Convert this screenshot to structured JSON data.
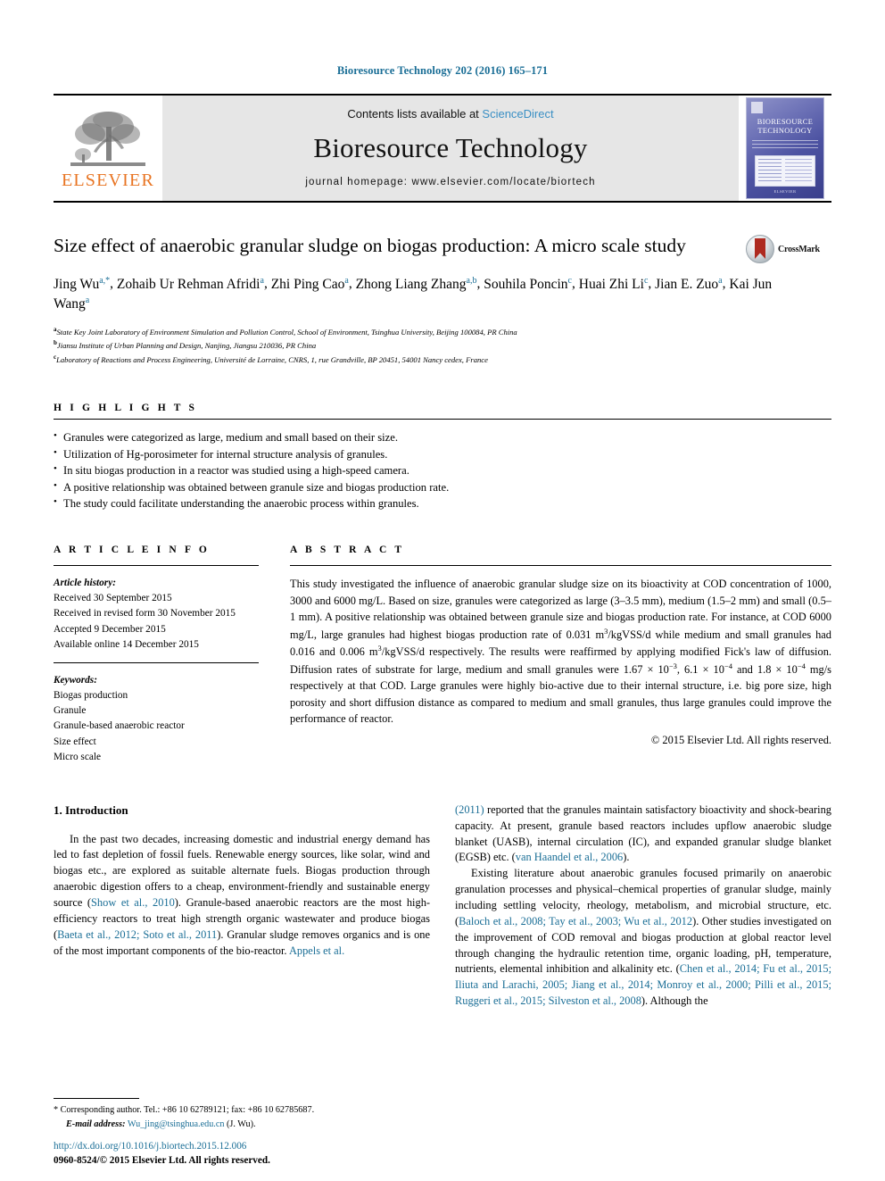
{
  "running_head": "Bioresource Technology 202 (2016) 165–171",
  "masthead": {
    "contents_prefix": "Contents lists available at ",
    "contents_link": "ScienceDirect",
    "journal_title": "Bioresource Technology",
    "homepage": "journal homepage: www.elsevier.com/locate/biortech",
    "publisher_name": "ELSEVIER",
    "cover_title_line1": "BIORESOURCE",
    "cover_title_line2": "TECHNOLOGY",
    "cover_footer": "ELSEVIER"
  },
  "article": {
    "title": "Size effect of anaerobic granular sludge on biogas production: A micro scale study",
    "crossmark_label": "CrossMark",
    "authors": [
      {
        "name": "Jing Wu",
        "marks": "a,*"
      },
      {
        "name": "Zohaib Ur Rehman Afridi",
        "marks": "a"
      },
      {
        "name": "Zhi Ping Cao",
        "marks": "a"
      },
      {
        "name": "Zhong Liang Zhang",
        "marks": "a,b"
      },
      {
        "name": "Souhila Poncin",
        "marks": "c"
      },
      {
        "name": "Huai Zhi Li",
        "marks": "c"
      },
      {
        "name": "Jian E. Zuo",
        "marks": "a"
      },
      {
        "name": "Kai Jun Wang",
        "marks": "a"
      }
    ],
    "affiliations": [
      {
        "mark": "a",
        "text": "State Key Joint Laboratory of Environment Simulation and Pollution Control, School of Environment, Tsinghua University, Beijing 100084, PR China"
      },
      {
        "mark": "b",
        "text": "Jiansu Institute of Urban Planning and Design, Nanjing, Jiangsu 210036, PR China"
      },
      {
        "mark": "c",
        "text": "Laboratory of Reactions and Process Engineering, Université de Lorraine, CNRS, 1, rue Grandville, BP 20451, 54001 Nancy cedex, France"
      }
    ]
  },
  "highlights": {
    "heading": "H I G H L I G H T S",
    "items": [
      "Granules were categorized as large, medium and small based on their size.",
      "Utilization of Hg-porosimeter for internal structure analysis of granules.",
      "In situ biogas production in a reactor was studied using a high-speed camera.",
      "A positive relationship was obtained between granule size and biogas production rate.",
      "The study could facilitate understanding the anaerobic process within granules."
    ]
  },
  "article_info": {
    "heading": "A R T I C L E   I N F O",
    "history_label": "Article history:",
    "history": [
      "Received 30 September 2015",
      "Received in revised form 30 November 2015",
      "Accepted 9 December 2015",
      "Available online 14 December 2015"
    ],
    "keywords_label": "Keywords:",
    "keywords": [
      "Biogas production",
      "Granule",
      "Granule-based anaerobic reactor",
      "Size effect",
      "Micro scale"
    ]
  },
  "abstract": {
    "heading": "A B S T R A C T",
    "paragraph_html": "This study investigated the influence of anaerobic granular sludge size on its bioactivity at COD concentration of 1000, 3000 and 6000 mg/L. Based on size, granules were categorized as large (3–3.5 mm), medium (1.5–2 mm) and small (0.5–1 mm). A positive relationship was obtained between granule size and biogas production rate. For instance, at COD 6000 mg/L, large granules had highest biogas production rate of 0.031 m<sup class=\"sup-sm\">3</sup>/kgVSS/d while medium and small granules had 0.016 and 0.006 m<sup class=\"sup-sm\">3</sup>/kgVSS/d respectively. The results were reaffirmed by applying modified Fick's law of diffusion. Diffusion rates of substrate for large, medium and small granules were 1.67 × 10<sup class=\"sup-sm\">−3</sup>, 6.1 × 10<sup class=\"sup-sm\">−4</sup> and 1.8 × 10<sup class=\"sup-sm\">−4</sup> mg/s respectively at that COD. Large granules were highly bio-active due to their internal structure, i.e. big pore size, high porosity and short diffusion distance as compared to medium and small granules, thus large granules could improve the performance of reactor.",
    "copyright": "© 2015 Elsevier Ltd. All rights reserved."
  },
  "introduction": {
    "heading": "1. Introduction",
    "left_paragraph_html": "In the past two decades, increasing domestic and industrial energy demand has led to fast depletion of fossil fuels. Renewable energy sources, like solar, wind and biogas etc., are explored as suitable alternate fuels. Biogas production through anaerobic digestion offers to a cheap, environment-friendly and sustainable energy source (<span class=\"ref\">Show et al., 2010</span>). Granule-based anaerobic reactors are the most high-efficiency reactors to treat high strength organic wastewater and produce biogas (<span class=\"ref\">Baeta et al., 2012; Soto et al., 2011</span>). Granular sludge removes organics and is one of the most important components of the bio-reactor. <span class=\"ref\">Appels et al.</span>",
    "right_paragraph1_html": "<span class=\"ref\">(2011)</span> reported that the granules maintain satisfactory bioactivity and shock-bearing capacity. At present, granule based reactors includes upflow anaerobic sludge blanket (UASB), internal circulation (IC), and expanded granular sludge blanket (EGSB) etc. (<span class=\"ref\">van Haandel et al., 2006</span>).",
    "right_paragraph2_html": "Existing literature about anaerobic granules focused primarily on anaerobic granulation processes and physical–chemical properties of granular sludge, mainly including settling velocity, rheology, metabolism, and microbial structure, etc. (<span class=\"ref\">Baloch et al., 2008; Tay et al., 2003; Wu et al., 2012</span>). Other studies investigated on the improvement of COD removal and biogas production at global reactor level through changing the hydraulic retention time, organic loading, pH, temperature, nutrients, elemental inhibition and alkalinity etc. (<span class=\"ref\">Chen et al., 2014; Fu et al., 2015; Iliuta and Larachi, 2005; Jiang et al., 2014; Monroy et al., 2000; Pilli et al., 2015; Ruggeri et al., 2015; Silveston et al., 2008</span>). Although the"
  },
  "footer": {
    "corresponding_html": "* Corresponding author. Tel.: +86 10 62789121; fax: +86 10 62785687.",
    "email_label": "E-mail address:",
    "email": "Wu_jing@tsinghua.edu.cn",
    "email_suffix": "(J. Wu).",
    "doi": "http://dx.doi.org/10.1016/j.biortech.2015.12.006",
    "issn_line": "0960-8524/© 2015 Elsevier Ltd. All rights reserved."
  },
  "colors": {
    "link_blue": "#1a6e96",
    "elsevier_orange": "#E87422",
    "masthead_grey": "#e6e6e6",
    "crossmark_red": "#ae2a20"
  }
}
